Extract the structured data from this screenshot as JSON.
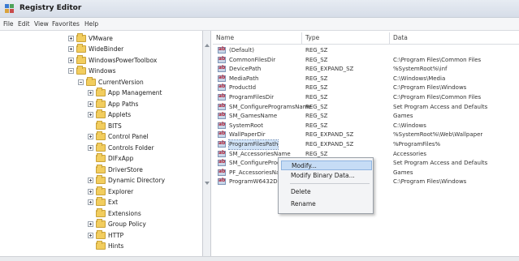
{
  "window": {
    "title": "Registry Editor"
  },
  "menu": [
    "File",
    "Edit",
    "View",
    "Favorites",
    "Help"
  ],
  "tree": {
    "nodes": [
      {
        "label": "VMware",
        "expander": "closed",
        "indent": 0
      },
      {
        "label": "WideBinder",
        "expander": "closed",
        "indent": 0
      },
      {
        "label": "WindowsPowerToolbox",
        "expander": "closed",
        "indent": 0
      },
      {
        "label": "Windows",
        "expander": "open",
        "indent": 0
      },
      {
        "label": "CurrentVersion",
        "expander": "open",
        "indent": 1
      },
      {
        "label": "App Management",
        "expander": "closed",
        "indent": 2
      },
      {
        "label": "App Paths",
        "expander": "closed",
        "indent": 2
      },
      {
        "label": "Applets",
        "expander": "closed",
        "indent": 2
      },
      {
        "label": "BITS",
        "expander": "none",
        "indent": 2
      },
      {
        "label": "Control Panel",
        "expander": "closed",
        "indent": 2
      },
      {
        "label": "Controls Folder",
        "expander": "closed",
        "indent": 2
      },
      {
        "label": "DIFxApp",
        "expander": "none",
        "indent": 2
      },
      {
        "label": "DriverStore",
        "expander": "none",
        "indent": 2
      },
      {
        "label": "Dynamic Directory",
        "expander": "closed",
        "indent": 2
      },
      {
        "label": "Explorer",
        "expander": "closed",
        "indent": 2
      },
      {
        "label": "Ext",
        "expander": "closed",
        "indent": 2
      },
      {
        "label": "Extensions",
        "expander": "none",
        "indent": 2
      },
      {
        "label": "Group Policy",
        "expander": "closed",
        "indent": 2
      },
      {
        "label": "HTTP",
        "expander": "closed",
        "indent": 2
      },
      {
        "label": "Hints",
        "expander": "none",
        "indent": 2
      }
    ]
  },
  "values": {
    "columns": {
      "name": "Name",
      "type": "Type",
      "data": "Data"
    },
    "rows": [
      {
        "name": "(Default)",
        "type": "REG_SZ",
        "data": ""
      },
      {
        "name": "CommonFilesDir",
        "type": "REG_SZ",
        "data": "C:\\Program Files\\Common Files"
      },
      {
        "name": "DevicePath",
        "type": "REG_EXPAND_SZ",
        "data": "%SystemRoot%\\inf"
      },
      {
        "name": "MediaPath",
        "type": "REG_SZ",
        "data": "C:\\Windows\\Media"
      },
      {
        "name": "ProductId",
        "type": "REG_SZ",
        "data": "C:\\Program Files\\Windows"
      },
      {
        "name": "ProgramFilesDir",
        "type": "REG_SZ",
        "data": "C:\\Program Files\\Common Files"
      },
      {
        "name": "SM_ConfigureProgramsName",
        "type": "REG_SZ",
        "data": "Set Program Access and Defaults"
      },
      {
        "name": "SM_GamesName",
        "type": "REG_SZ",
        "data": "Games"
      },
      {
        "name": "SystemRoot",
        "type": "REG_SZ",
        "data": "C:\\Windows"
      },
      {
        "name": "WallPaperDir",
        "type": "REG_EXPAND_SZ",
        "data": "%SystemRoot%\\Web\\Wallpaper"
      },
      {
        "name": "ProgramFilesPath",
        "type": "REG_EXPAND_SZ",
        "data": "%ProgramFiles%"
      },
      {
        "name": "SM_AccessoriesName",
        "type": "REG_SZ",
        "data": "Accessories"
      },
      {
        "name": "SM_ConfigurePrograms",
        "type": "REG_SZ",
        "data": "Set Program Access and Defaults"
      },
      {
        "name": "PF_AccessoriesName",
        "type": "REG_SZ",
        "data": "Games"
      },
      {
        "name": "ProgramW6432Dir",
        "type": "REG_SZ",
        "data": "C:\\Program Files\\Windows"
      }
    ]
  },
  "context_menu": {
    "items": [
      "Modify...",
      "Modify Binary Data...",
      "Delete",
      "Rename"
    ]
  }
}
